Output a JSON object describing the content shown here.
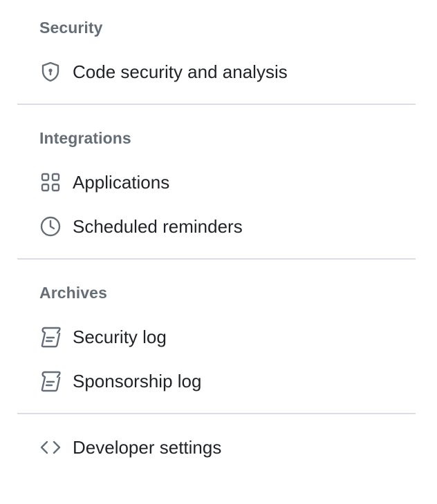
{
  "sections": {
    "security": {
      "heading": "Security",
      "items": [
        {
          "label": "Code security and analysis",
          "icon": "shield-lock-icon"
        }
      ]
    },
    "integrations": {
      "heading": "Integrations",
      "items": [
        {
          "label": "Applications",
          "icon": "apps-icon"
        },
        {
          "label": "Scheduled reminders",
          "icon": "clock-icon"
        }
      ]
    },
    "archives": {
      "heading": "Archives",
      "items": [
        {
          "label": "Security log",
          "icon": "log-icon"
        },
        {
          "label": "Sponsorship log",
          "icon": "log-icon"
        }
      ]
    },
    "developer": {
      "items": [
        {
          "label": "Developer settings",
          "icon": "code-icon"
        }
      ]
    }
  },
  "colors": {
    "heading": "#656d76",
    "text": "#1f2328",
    "icon": "#656d76",
    "divider": "#d8dee4"
  }
}
